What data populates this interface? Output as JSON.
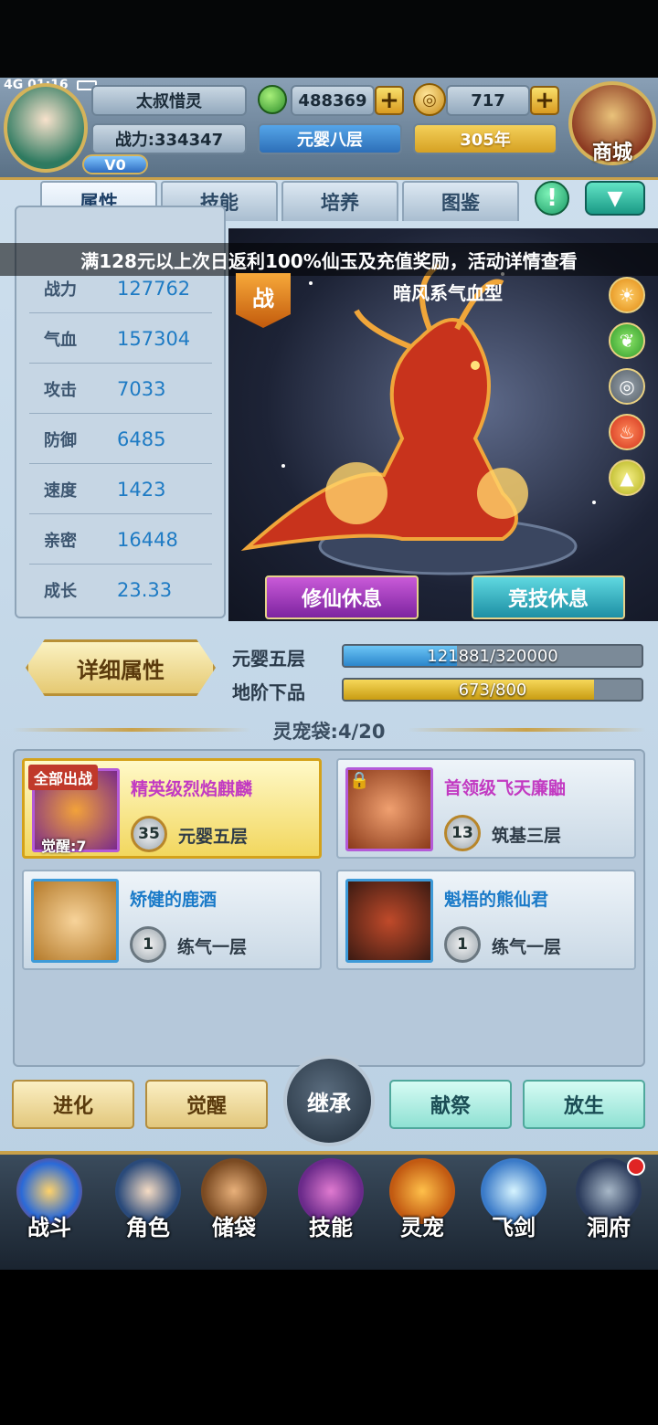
{
  "status": {
    "network": "4G",
    "time": "01:16"
  },
  "player": {
    "name": "太叔惜灵",
    "power": "战力:334347",
    "vip": "V0",
    "realm": "元婴八层",
    "age": "305年"
  },
  "currency": {
    "jade": "488369",
    "gold": "717"
  },
  "shop": {
    "label": "商城"
  },
  "tabs": [
    "属性",
    "技能",
    "培养",
    "图鉴"
  ],
  "banner": "满128元以上次日返利100%仙玉及充值奖励，活动详情查看",
  "pet": {
    "type": "暗风系气血型",
    "battle_badge": "战",
    "stats": [
      {
        "label": "战力",
        "value": "127762"
      },
      {
        "label": "气血",
        "value": "157304"
      },
      {
        "label": "攻击",
        "value": "7033"
      },
      {
        "label": "防御",
        "value": "6485"
      },
      {
        "label": "速度",
        "value": "1423"
      },
      {
        "label": "亲密",
        "value": "16448"
      },
      {
        "label": "成长",
        "value": "23.33"
      }
    ],
    "rest_buttons": {
      "cultivate": "修仙休息",
      "arena": "竞技休息"
    },
    "detail_button": "详细属性",
    "progress": [
      {
        "label": "元婴五层",
        "text": "121881/320000",
        "fraction": 0.381
      },
      {
        "label": "地阶下品",
        "text": "673/800",
        "fraction": 0.841
      }
    ]
  },
  "bag": {
    "label": "灵宠袋:4/20"
  },
  "pet_list": [
    {
      "name": "精英级烈焰麒麟",
      "level": "35",
      "realm": "元婴五层",
      "tag": "全部出战",
      "awake": "觉醒:7"
    },
    {
      "name": "首领级飞天廉鼬",
      "level": "13",
      "realm": "筑基三层"
    },
    {
      "name": "矫健的鹿酒",
      "level": "1",
      "realm": "练气一层"
    },
    {
      "name": "魁梧的熊仙君",
      "level": "1",
      "realm": "练气一层"
    }
  ],
  "actions": {
    "evolve": "进化",
    "awaken": "觉醒",
    "inherit": "继承",
    "sacrifice": "献祭",
    "release": "放生"
  },
  "nav": [
    {
      "label": "战斗",
      "icon": "battle-icon"
    },
    {
      "label": "角色",
      "icon": "character-icon"
    },
    {
      "label": "储袋",
      "icon": "storage-bag-icon"
    },
    {
      "label": "技能",
      "icon": "skill-icon"
    },
    {
      "label": "灵宠",
      "icon": "spirit-pet-icon"
    },
    {
      "label": "飞剑",
      "icon": "flying-sword-icon"
    },
    {
      "label": "洞府",
      "icon": "cave-dwelling-icon"
    }
  ]
}
